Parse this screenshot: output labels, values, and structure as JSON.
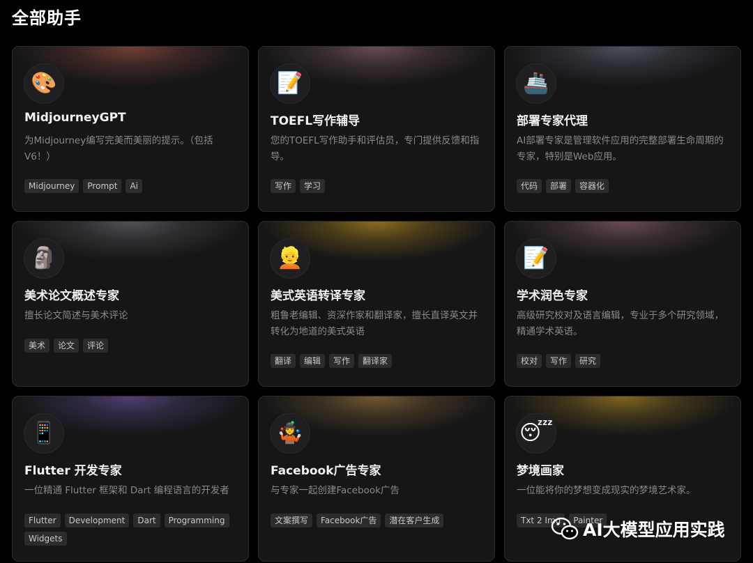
{
  "page": {
    "title": "全部助手"
  },
  "cards": [
    {
      "icon": "palette-icon",
      "emoji": "🎨",
      "name": "MidjourneyGPT",
      "desc": "为Midjourney编写完美而美丽的提示。（包括V6！）",
      "tags": [
        "Midjourney",
        "Prompt",
        "Ai"
      ],
      "glow": "#8a4a40"
    },
    {
      "icon": "memo-icon",
      "emoji": "📝",
      "name": "TOEFL写作辅导",
      "desc": "您的TOEFL写作助手和评估员，专门提供反馈和指导。",
      "tags": [
        "写作",
        "学习"
      ],
      "glow": "#7d5a62"
    },
    {
      "icon": "ship-icon",
      "emoji": "🚢",
      "name": "部署专家代理",
      "desc": "AI部署专家是管理软件应用的完整部署生命周期的专家，特别是Web应用。",
      "tags": [
        "代码",
        "部署",
        "容器化"
      ],
      "glow": "#5a5f6e"
    },
    {
      "icon": "moai-icon",
      "emoji": "🗿",
      "name": "美术论文概述专家",
      "desc": "擅长论文简述与美术评论",
      "tags": [
        "美术",
        "论文",
        "评论"
      ],
      "glow": "#5f6066"
    },
    {
      "icon": "person-blond-icon",
      "emoji": "👱",
      "name": "美式英语转译专家",
      "desc": "粗鲁老编辑、资深作家和翻译家，擅长直译英文并转化为地道的美式英语",
      "tags": [
        "翻译",
        "编辑",
        "写作",
        "翻译家"
      ],
      "glow": "#a8821f"
    },
    {
      "icon": "memo-icon",
      "emoji": "📝",
      "name": "学术润色专家",
      "desc": "高级研究校对及语言编辑，专业于多个研究领域，精通学术英语。",
      "tags": [
        "校对",
        "写作",
        "研究"
      ],
      "glow": "#7d5a62"
    },
    {
      "icon": "mobile-app-icon",
      "emoji": "📱",
      "name": "Flutter 开发专家",
      "desc": "一位精通 Flutter 框架和 Dart 编程语言的开发者",
      "tags": [
        "Flutter",
        "Development",
        "Dart",
        "Programming",
        "Widgets"
      ],
      "glow": "#5e4a8a"
    },
    {
      "icon": "juggler-icon",
      "emoji": "🤹",
      "name": "Facebook广告专家",
      "desc": "与专家一起创建Facebook广告",
      "tags": [
        "文案撰写",
        "Facebook广告",
        "潜在客户生成"
      ],
      "glow": "#8a6a3a"
    },
    {
      "icon": "sleeping-face-icon",
      "emoji": "😴",
      "name": "梦境画家",
      "desc": "一位能将你的梦想变成现实的梦境艺术家。",
      "tags": [
        "Txt 2 Img",
        "Painter"
      ],
      "glow": "#9a7a22"
    }
  ],
  "watermark": {
    "text": "AI大模型应用实践",
    "icon": "wechat-icon"
  }
}
